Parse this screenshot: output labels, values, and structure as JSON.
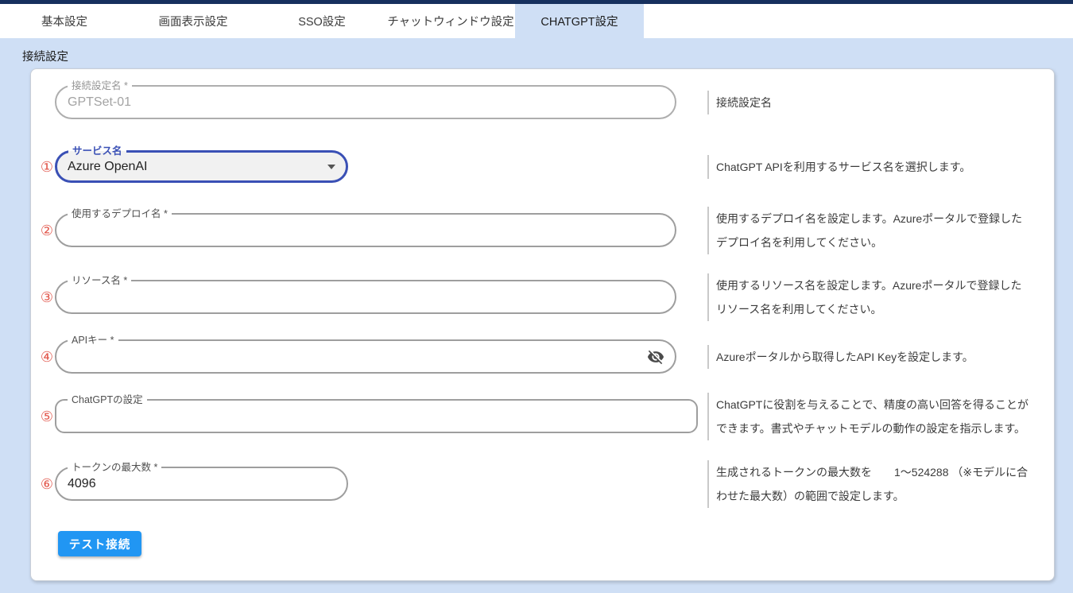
{
  "tabs": {
    "items": [
      {
        "label": "基本設定",
        "active": false
      },
      {
        "label": "画面表示設定",
        "active": false
      },
      {
        "label": "SSO設定",
        "active": false
      },
      {
        "label": "チャットウィンドウ設定",
        "active": false
      },
      {
        "label": "CHATGPT設定",
        "active": true
      }
    ]
  },
  "section": {
    "title": "接続設定"
  },
  "form": {
    "fields": [
      {
        "num": "",
        "label": "接続設定名 *",
        "value": "GPTSet-01",
        "state": "disabled",
        "description": "接続設定名"
      },
      {
        "num": "①",
        "label": "サービス名",
        "value": "Azure OpenAI",
        "state": "focused-select",
        "description": "ChatGPT APIを利用するサービス名を選択します。"
      },
      {
        "num": "②",
        "label": "使用するデプロイ名 *",
        "value": "",
        "state": "empty",
        "description": "使用するデプロイ名を設定します。Azureポータルで登録したデプロイ名を利用してください。"
      },
      {
        "num": "③",
        "label": "リソース名 *",
        "value": "",
        "state": "empty",
        "description": "使用するリソース名を設定します。Azureポータルで登録したリソース名を利用してください。"
      },
      {
        "num": "④",
        "label": "APIキー *",
        "value": "",
        "state": "empty-password",
        "description": "Azureポータルから取得したAPI Keyを設定します。"
      },
      {
        "num": "⑤",
        "label": "ChatGPTの設定",
        "value": "",
        "state": "empty",
        "description": "ChatGPTに役割を与えることで、精度の高い回答を得ることができます。書式やチャットモデルの動作の設定を指示します。"
      },
      {
        "num": "⑥",
        "label": "トークンの最大数 *",
        "value": "4096",
        "state": "filled",
        "description": "生成されるトークンの最大数を　　1～524288 （※モデルに合わせた最大数）の範囲で設定します。"
      }
    ],
    "test_button": "テスト接続"
  },
  "colors": {
    "topbar": "#16305e",
    "page_bg": "#cfdff5",
    "select_border": "#3a50b5",
    "number_red": "#e2574c",
    "button_blue": "#2196f3"
  }
}
